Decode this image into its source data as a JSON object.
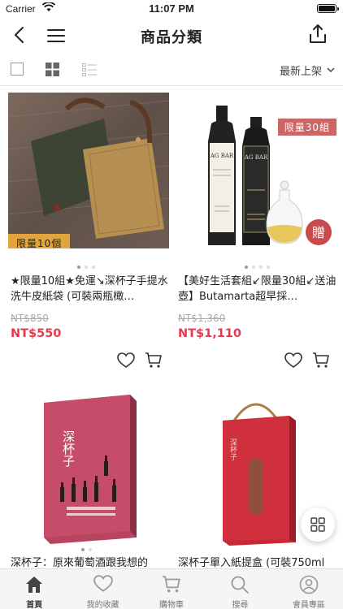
{
  "status_bar": {
    "carrier": "Carrier",
    "time": "11:07 PM"
  },
  "nav": {
    "title": "商品分類"
  },
  "toolbar": {
    "sort_label": "最新上架"
  },
  "products": [
    {
      "name": "★限量10組★免運↘深杯子手提水洗牛皮紙袋 (可裝兩瓶橄…",
      "original_price": "NT$850",
      "price": "NT$550",
      "badge": "限量10個"
    },
    {
      "name": "【美好生活套組↙限量30組↙送油壺】Butamarta超早採…",
      "original_price": "NT$1,360",
      "price": "NT$1,110",
      "badge": "限量30組",
      "gift_label": "贈",
      "bottle_brand_1": "AG BAR",
      "bottle_brand_2": "AG BAR"
    },
    {
      "name": "深杯子：原來葡萄酒跟我想的",
      "book_title": "深杯子"
    },
    {
      "name": "深杯子單入紙提盒 (可裝750ml",
      "box_text": "深杯子"
    }
  ],
  "tabs": [
    {
      "label": "首頁",
      "icon": "home-icon"
    },
    {
      "label": "我的收藏",
      "icon": "heart-icon"
    },
    {
      "label": "購物車",
      "icon": "cart-icon"
    },
    {
      "label": "搜尋",
      "icon": "search-icon"
    },
    {
      "label": "會員專區",
      "icon": "user-icon"
    }
  ],
  "colors": {
    "price_red": "#e8384f",
    "badge_orange": "#e8aa3c",
    "badge_pink": "#c66666"
  }
}
